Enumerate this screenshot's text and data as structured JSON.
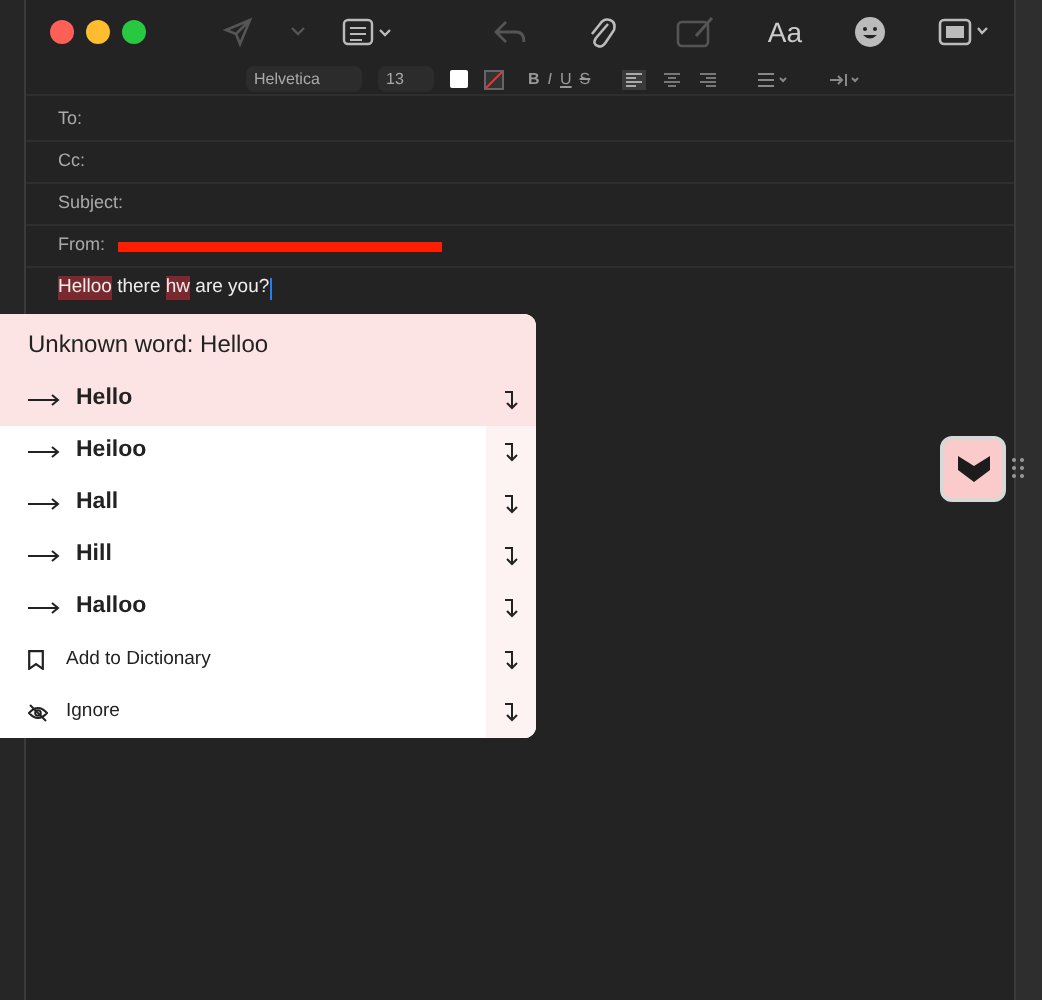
{
  "toolbar": {
    "format_label": "Aa"
  },
  "format_bar": {
    "font": "Helvetica",
    "size": "13",
    "styles": [
      "B",
      "I",
      "U",
      "S"
    ]
  },
  "header_fields": [
    {
      "label": "To:"
    },
    {
      "label": "Cc:"
    },
    {
      "label": "Subject:"
    },
    {
      "label": "From:",
      "redacted": true
    }
  ],
  "body": {
    "segments": [
      {
        "text": "Helloo",
        "misspelled": true
      },
      {
        "text": " there ",
        "misspelled": false
      },
      {
        "text": "hw",
        "misspelled": true
      },
      {
        "text": " are you?",
        "misspelled": false
      }
    ]
  },
  "popup": {
    "title": "Unknown word: Helloo",
    "items": [
      {
        "kind": "suggestion",
        "label": "Hello",
        "selected": true
      },
      {
        "kind": "suggestion",
        "label": "Heiloo",
        "selected": false
      },
      {
        "kind": "suggestion",
        "label": "Hall",
        "selected": false
      },
      {
        "kind": "suggestion",
        "label": "Hill",
        "selected": false
      },
      {
        "kind": "suggestion",
        "label": "Halloo",
        "selected": false
      },
      {
        "kind": "add",
        "label": "Add to Dictionary",
        "selected": false
      },
      {
        "kind": "ignore",
        "label": "Ignore",
        "selected": false
      }
    ]
  }
}
